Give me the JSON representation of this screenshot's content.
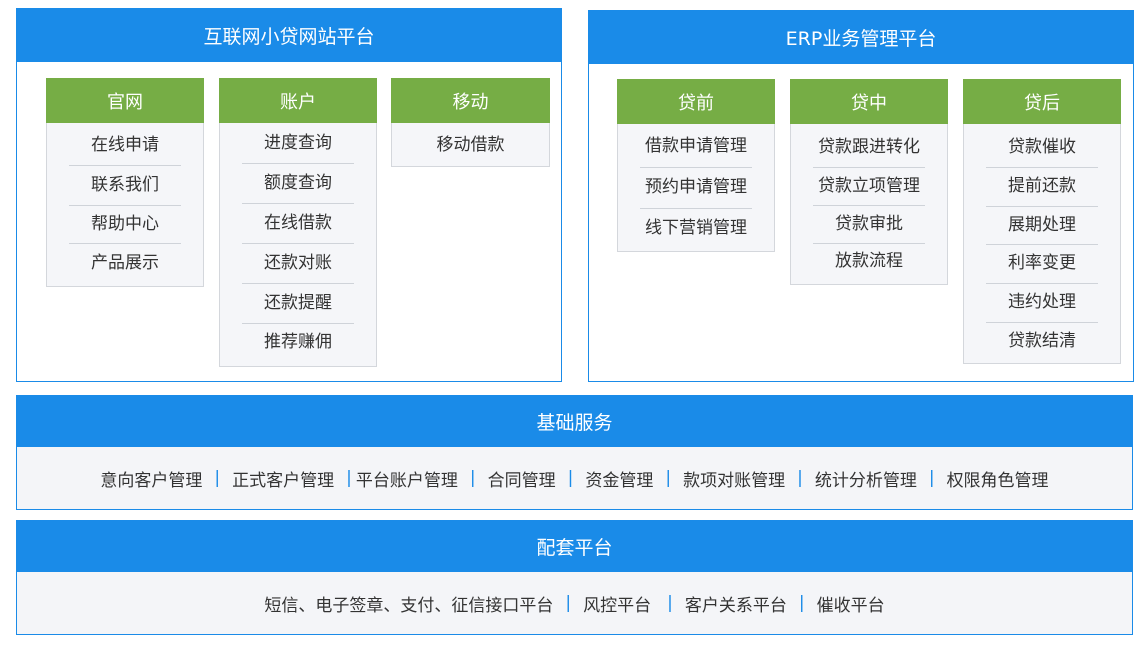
{
  "web_platform": {
    "title": "互联网小贷网站平台",
    "columns": [
      {
        "title": "官网",
        "items": [
          "在线申请",
          "联系我们",
          "帮助中心",
          "产品展示"
        ]
      },
      {
        "title": "账户",
        "items": [
          "进度查询",
          "额度查询",
          "在线借款",
          "还款对账",
          "还款提醒",
          "推荐赚佣"
        ]
      },
      {
        "title": "移动",
        "items": [
          "移动借款"
        ]
      }
    ]
  },
  "erp_platform": {
    "title": "ERP业务管理平台",
    "columns": [
      {
        "title": "贷前",
        "items": [
          "借款申请管理",
          "预约申请管理",
          "线下营销管理"
        ]
      },
      {
        "title": "贷中",
        "items": [
          "贷款跟进转化",
          "贷款立项管理",
          "贷款审批",
          "放款流程"
        ]
      },
      {
        "title": "贷后",
        "items": [
          "贷款催收",
          "提前还款",
          "展期处理",
          "利率变更",
          "违约处理",
          "贷款结清"
        ]
      }
    ]
  },
  "base_services": {
    "title": "基础服务",
    "items": [
      "意向客户管理",
      "正式客户管理",
      "平台账户管理",
      "合同管理",
      "资金管理",
      "款项对账管理",
      "统计分析管理",
      "权限角色管理"
    ]
  },
  "support_platform": {
    "title": "配套平台",
    "items": [
      "短信、电子签章、支付、征信接口平台",
      "风控平台",
      "客户关系平台",
      "催收平台"
    ]
  },
  "colors": {
    "blue": "#1a8be8",
    "green": "#76ad45"
  }
}
